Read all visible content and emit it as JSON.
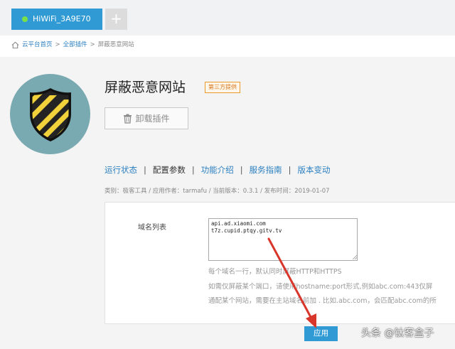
{
  "topbar": {
    "device_name": "HiWiFi_3A9E70",
    "device_status_color": "#7ae04a",
    "add_label": "+"
  },
  "breadcrumb": {
    "home": "云平台首页",
    "sep1": ">",
    "all_plugins": "全部插件",
    "sep2": ">",
    "current": "屏蔽恶意网站"
  },
  "plugin": {
    "title": "屏蔽恶意网站",
    "badge": "第三方提供",
    "uninstall_label": "卸载插件",
    "meta": "类别：极客工具 / 应用作者：tarmafu / 当前版本：0.3.1 / 发布时间：2019-01-07"
  },
  "nav": {
    "items": [
      {
        "label": "运行状态"
      },
      {
        "label": "配置参数"
      },
      {
        "label": "功能介绍"
      },
      {
        "label": "服务指南"
      },
      {
        "label": "版本变动"
      }
    ],
    "separator": "|",
    "active_index": 1
  },
  "settings": {
    "domain_label": "域名列表",
    "domain_value": "api.ad.xiaomi.com\nt7z.cupid.ptqy.gitv.tv",
    "hints": [
      "每个域名一行，默认同时屏蔽HTTP和HTTPS",
      "如需仅屏蔽某个端口，请使用hostname:port形式,例如abc.com:443仅屏",
      "通配某个网站，需要在主站域名前加 . 比如.abc.com，会匹配abc.com的所"
    ],
    "apply_label": "应用"
  },
  "watermark": "头条 @钛客盒子",
  "colors": {
    "accent": "#2f9ad4",
    "link": "#2a7fc0",
    "badge": "#e99a2a",
    "arrow": "#d9362b"
  }
}
